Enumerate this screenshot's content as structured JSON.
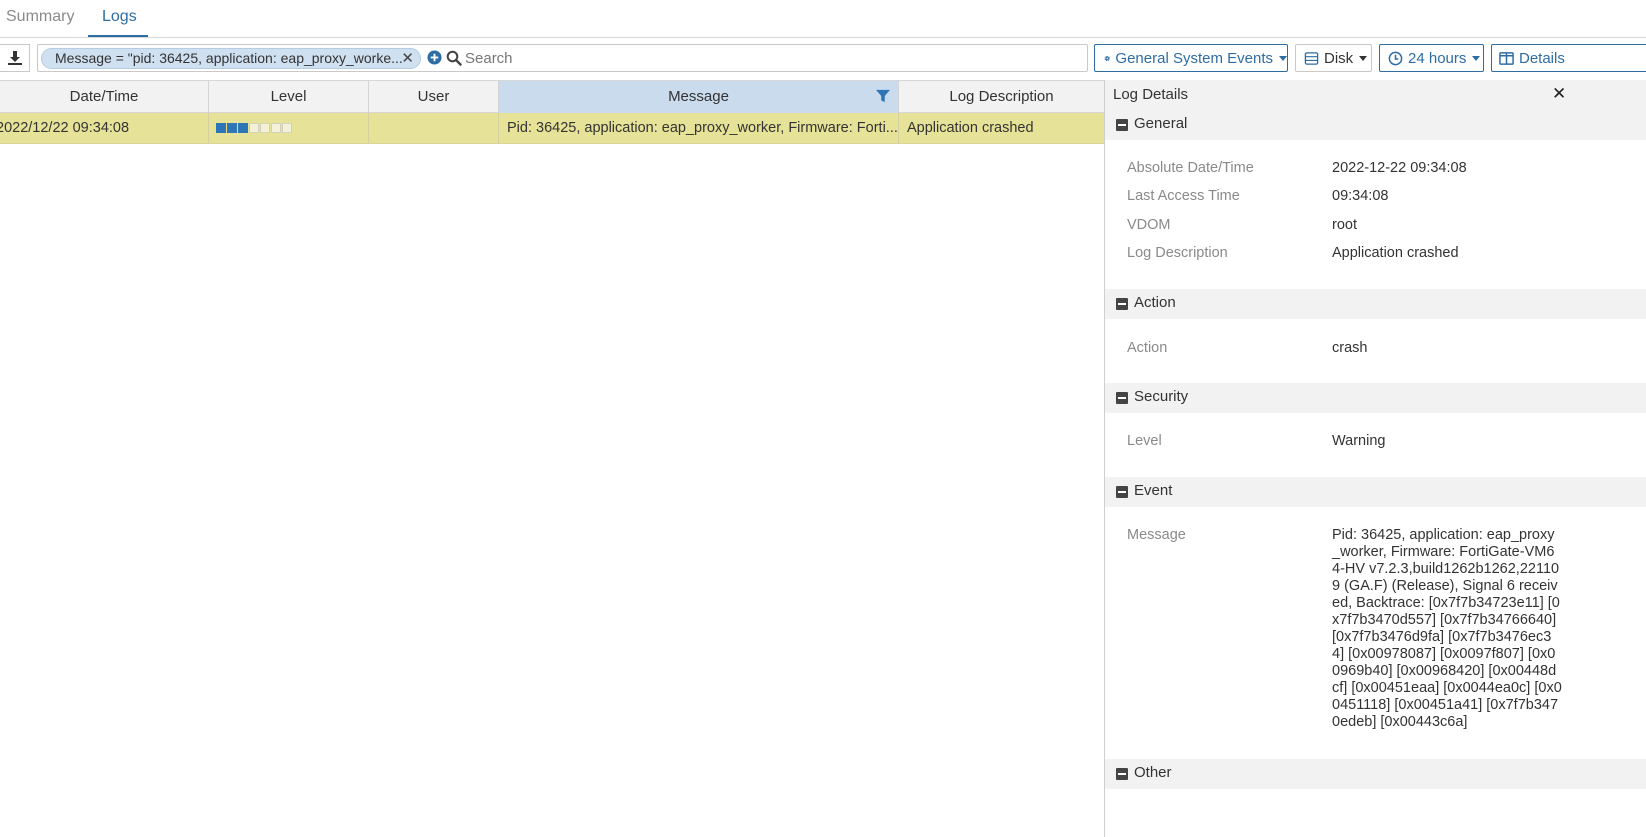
{
  "tabs": [
    {
      "label": "Summary",
      "active": false
    },
    {
      "label": "Logs",
      "active": true
    }
  ],
  "toolbar": {
    "filter_chip": "Message = \"pid: 36425, application: eap_proxy_worke...",
    "search_placeholder": "Search",
    "events_label": "General System Events",
    "disk_label": "Disk",
    "time_label": "24 hours",
    "details_label": "Details"
  },
  "table": {
    "headers": [
      "Date/Time",
      "Level",
      "User",
      "Message",
      "Log Description"
    ],
    "rows": [
      {
        "datetime": "2022/12/22 09:34:08",
        "level_filled": 3,
        "level_total": 7,
        "user": "",
        "message": "Pid: 36425, application: eap_proxy_worker, Firmware: Forti...",
        "description": "Application crashed"
      }
    ]
  },
  "details": {
    "title": "Log Details",
    "sections": {
      "general": {
        "title": "General",
        "items": [
          {
            "key": "Absolute Date/Time",
            "value": "2022-12-22 09:34:08"
          },
          {
            "key": "Last Access Time",
            "value": "09:34:08"
          },
          {
            "key": "VDOM",
            "value": "root"
          },
          {
            "key": "Log Description",
            "value": "Application crashed"
          }
        ]
      },
      "action": {
        "title": "Action",
        "items": [
          {
            "key": "Action",
            "value": "crash"
          }
        ]
      },
      "security": {
        "title": "Security",
        "items": [
          {
            "key": "Level",
            "value": "Warning"
          }
        ]
      },
      "event": {
        "title": "Event",
        "items": [
          {
            "key": "Message",
            "value": "Pid: 36425, application: eap_proxy_worker, Firmware: FortiGate-VM64-HV v7.2.3,build1262b1262,221109 (GA.F) (Release), Signal 6 received, Backtrace: [0x7f7b34723e11] [0x7f7b3470d557] [0x7f7b34766640] [0x7f7b3476d9fa] [0x7f7b3476ec34] [0x00978087] [0x0097f807] [0x00969b40] [0x00968420] [0x00448dcf] [0x00451eaa] [0x0044ea0c] [0x00451118] [0x00451a41] [0x7f7b3470edeb] [0x00443c6a]"
          }
        ]
      },
      "other": {
        "title": "Other"
      }
    }
  },
  "colors": {
    "accent": "#2e6da4",
    "selected_row": "#e6e398",
    "level_on": "#2e75b6"
  }
}
